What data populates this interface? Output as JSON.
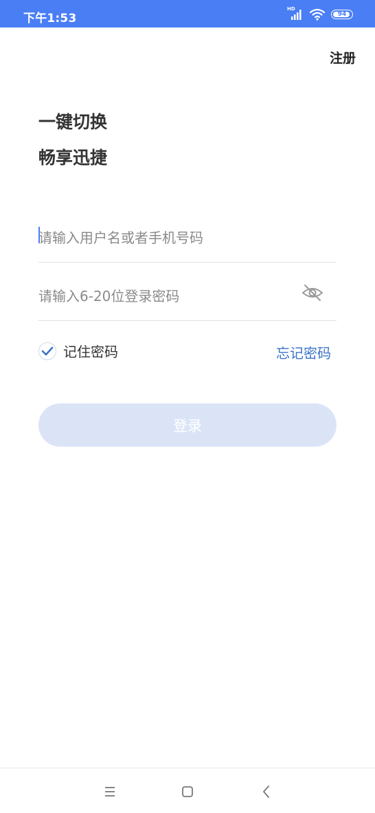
{
  "status_bar": {
    "time": "下午1:53",
    "network": "HD",
    "battery": "94",
    "battery_level": 0.94,
    "background_color": "#4a7ef5"
  },
  "header": {
    "register_label": "注册"
  },
  "headline": {
    "line1": "一键切换",
    "line2": "畅享迅捷"
  },
  "form": {
    "username": {
      "value": "",
      "placeholder": "请输入用户名或者手机号码"
    },
    "password": {
      "value": "",
      "placeholder": "请输入6-20位登录密码",
      "visibility_icon": "eye-off-icon"
    },
    "remember": {
      "label": "记住密码",
      "checked": true
    },
    "forgot_label": "忘记密码",
    "login_label": "登录"
  },
  "nav_bar": {
    "icons": [
      "menu-icon",
      "home-icon",
      "back-icon"
    ]
  },
  "colors": {
    "accent": "#4a7ef5",
    "link": "#3b74c9",
    "button_disabled": "#dbe4f7"
  }
}
